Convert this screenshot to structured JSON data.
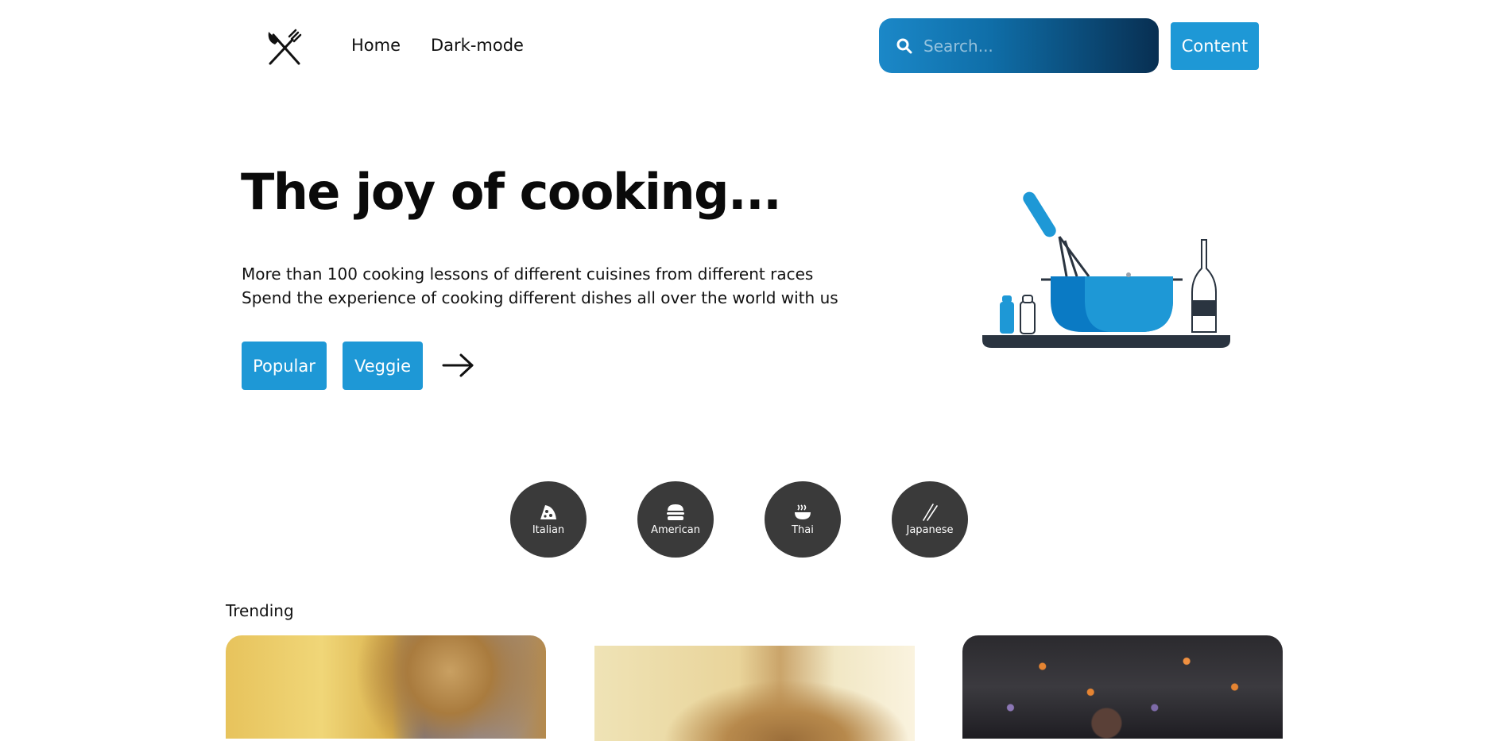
{
  "header": {
    "logo_icon": "fork-knife-icon",
    "nav": [
      {
        "label": "Home"
      },
      {
        "label": "Dark-mode"
      }
    ],
    "search": {
      "placeholder": "Search...",
      "icon": "search-icon"
    },
    "content_button": "Content"
  },
  "hero": {
    "title": "The joy of cooking...",
    "lines": [
      "More than 100 cooking lessons of different cuisines from different races",
      "Spend the experience of cooking different dishes all over the world with us"
    ],
    "buttons": [
      "Popular",
      "Veggie"
    ],
    "arrow_icon": "arrow-right-icon",
    "illustration": "cooking-pot-illustration"
  },
  "categories": [
    {
      "label": "Italian",
      "icon": "pizza-icon"
    },
    {
      "label": "American",
      "icon": "burger-icon"
    },
    {
      "label": "Thai",
      "icon": "noodle-bowl-icon"
    },
    {
      "label": "Japanese",
      "icon": "chopsticks-icon"
    }
  ],
  "trending": {
    "label": "Trending"
  },
  "colors": {
    "accent": "#1e98d6",
    "category_bg": "#3a3a3a",
    "search_gradient_end": "#082f52"
  }
}
